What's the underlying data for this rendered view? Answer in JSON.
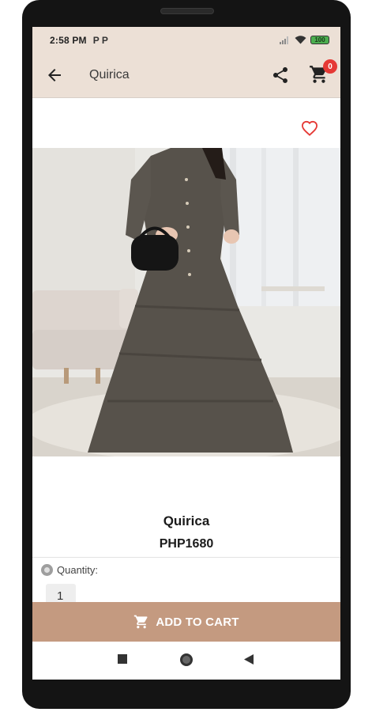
{
  "status_bar": {
    "time": "2:58 PM",
    "notification_icons": "P P",
    "battery": "100"
  },
  "toolbar": {
    "title": "Quirica",
    "cart_count": "0"
  },
  "product": {
    "name": "Quirica",
    "price": "PHP1680",
    "image_description": "woman-in-dark-brown-tiered-maxi-dress"
  },
  "quantity": {
    "label": "Quantity:",
    "value": "1"
  },
  "actions": {
    "add_to_cart_label": "ADD TO CART"
  },
  "icons": {
    "back": "arrow-back-icon",
    "share": "share-icon",
    "cart": "cart-icon",
    "favorite": "heart-outline-icon",
    "nav_recents": "square-icon",
    "nav_home": "circle-icon",
    "nav_back": "triangle-back-icon"
  },
  "colors": {
    "toolbar_bg": "#ece0d6",
    "button_bg": "#c49a80",
    "badge": "#e53935",
    "heart": "#e53935"
  }
}
